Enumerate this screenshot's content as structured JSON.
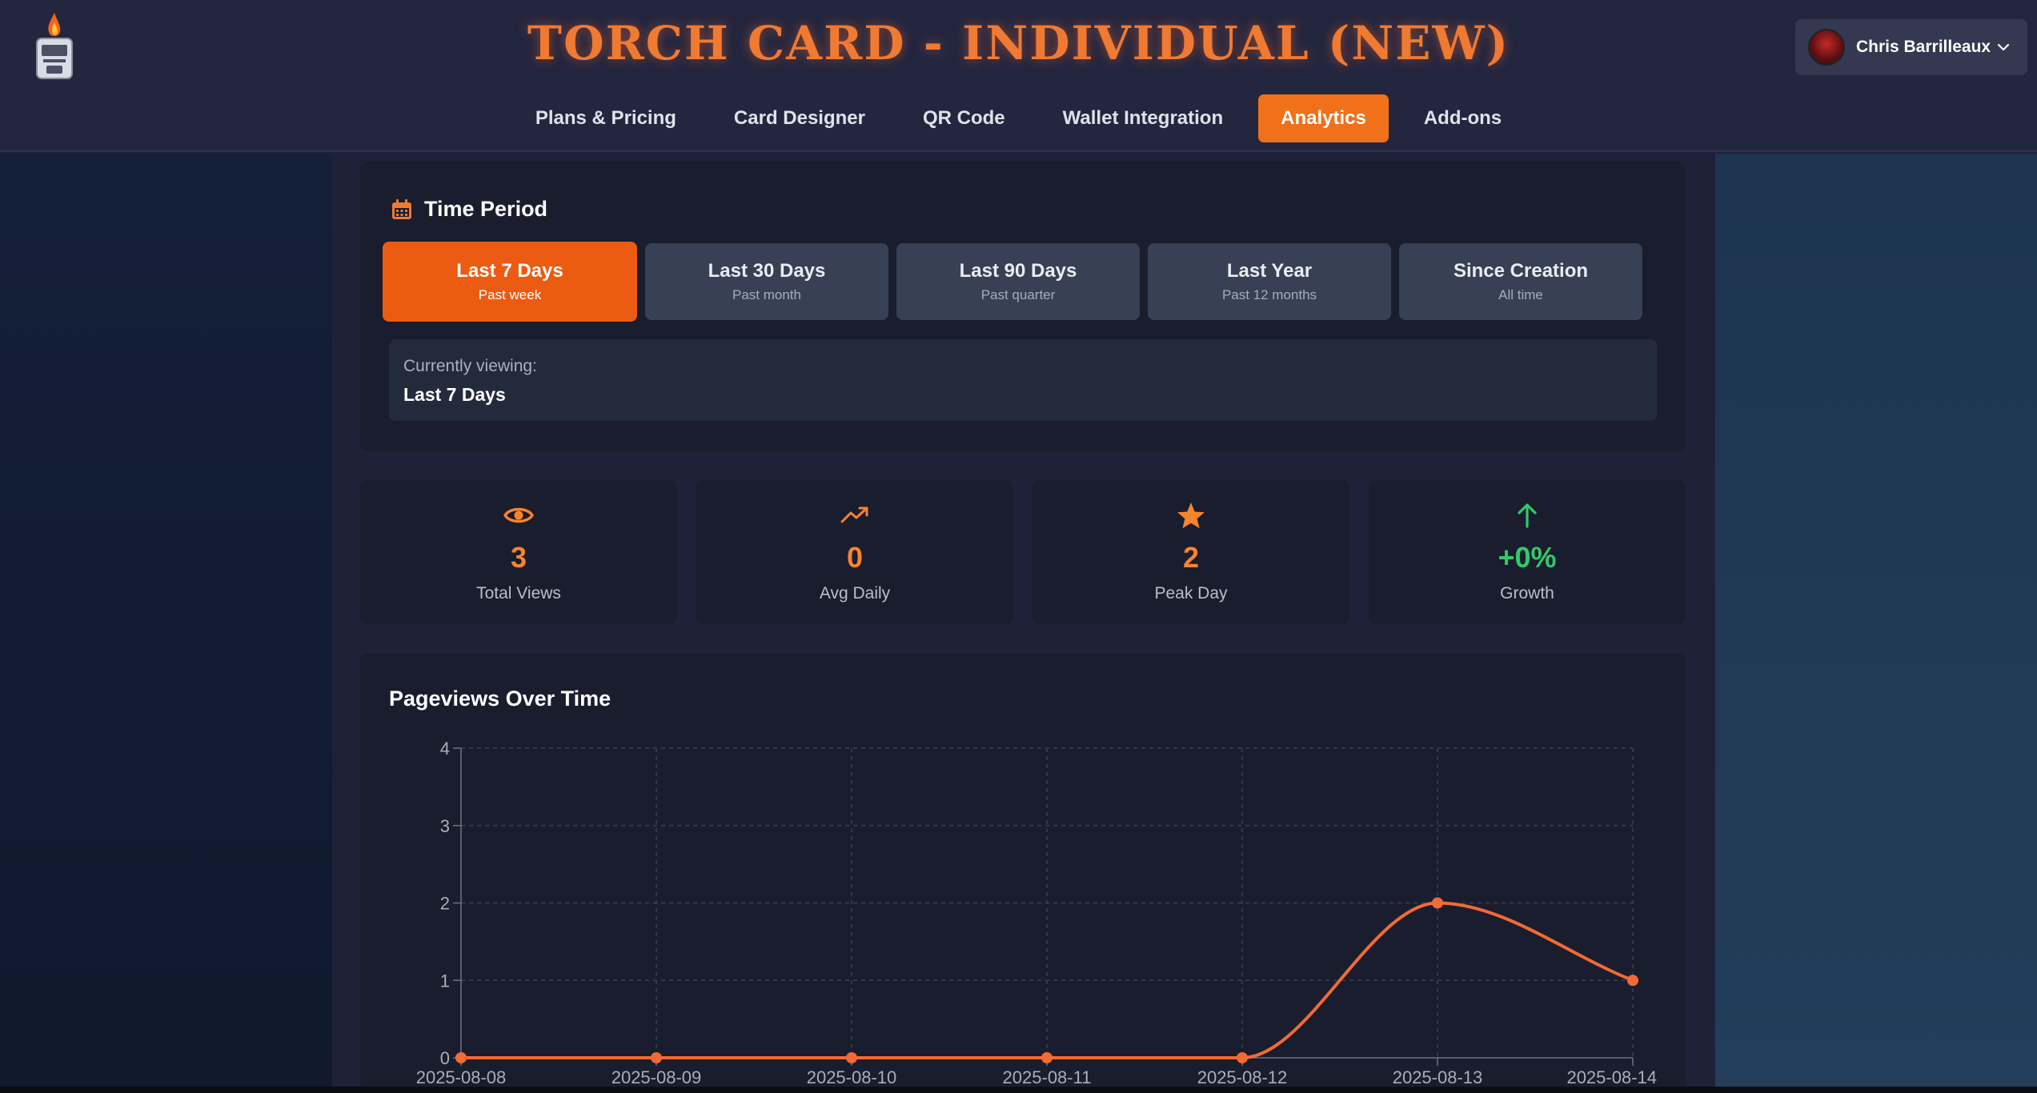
{
  "header": {
    "title": "TORCH CARD - INDIVIDUAL (NEW)",
    "nav": [
      {
        "label": "Plans & Pricing",
        "active": false
      },
      {
        "label": "Card Designer",
        "active": false
      },
      {
        "label": "QR Code",
        "active": false
      },
      {
        "label": "Wallet Integration",
        "active": false
      },
      {
        "label": "Analytics",
        "active": true
      },
      {
        "label": "Add-ons",
        "active": false
      }
    ],
    "user": {
      "name": "Chris Barrilleaux"
    }
  },
  "time_period": {
    "title": "Time Period",
    "icon": "calendar-icon",
    "options": [
      {
        "label": "Last 7 Days",
        "sub": "Past week",
        "active": true
      },
      {
        "label": "Last 30 Days",
        "sub": "Past month",
        "active": false
      },
      {
        "label": "Last 90 Days",
        "sub": "Past quarter",
        "active": false
      },
      {
        "label": "Last Year",
        "sub": "Past 12 months",
        "active": false
      },
      {
        "label": "Since Creation",
        "sub": "All time",
        "active": false
      }
    ],
    "viewing_label": "Currently viewing:",
    "viewing_value": "Last 7 Days"
  },
  "stats": [
    {
      "icon": "eye-icon",
      "value": "3",
      "label": "Total Views",
      "color": "#f7842e"
    },
    {
      "icon": "trending-up-icon",
      "value": "0",
      "label": "Avg Daily",
      "color": "#f7842e"
    },
    {
      "icon": "star-icon",
      "value": "2",
      "label": "Peak Day",
      "color": "#f7842e"
    },
    {
      "icon": "arrow-up-icon",
      "value": "+0%",
      "label": "Growth",
      "color": "#34c86d"
    }
  ],
  "colors": {
    "accent": "#f1701a",
    "line": "#f26a35",
    "growth": "#34c86d"
  },
  "chart_data": {
    "type": "line",
    "title": "Pageviews Over Time",
    "x": [
      "2025-08-08",
      "2025-08-09",
      "2025-08-10",
      "2025-08-11",
      "2025-08-12",
      "2025-08-13",
      "2025-08-14"
    ],
    "series": [
      {
        "values": [
          0,
          0,
          0,
          0,
          0,
          2,
          1
        ]
      }
    ],
    "ylim": [
      0,
      4
    ],
    "yticks": [
      0,
      1,
      2,
      3,
      4
    ],
    "grid": true
  }
}
